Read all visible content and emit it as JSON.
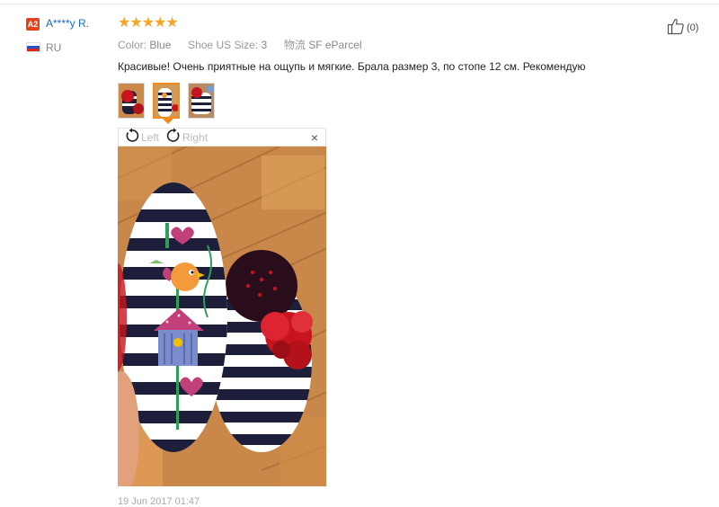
{
  "reviewer": {
    "badge": "A2",
    "name": "A****y R.",
    "country": "RU"
  },
  "review": {
    "rating": "★★★★★",
    "attributes": [
      {
        "label": "Color:",
        "value": "Blue"
      },
      {
        "label": "Shoe US Size:",
        "value": "3"
      },
      {
        "label": "物流",
        "value": "SF eParcel"
      }
    ],
    "helpful_count": "(0)",
    "text": "Красивые! Очень приятные на ощупь и мягкие. Брала размер 3, по стопе 12 см. Рекомендую",
    "date": "19 Jun 2017 01:47"
  },
  "viewer": {
    "rotate_left_label": "Left",
    "rotate_right_label": "Right",
    "close_label": "×"
  },
  "colors": {
    "accent": "#f08c1e",
    "star": "#f5a623",
    "link": "#1e69b8",
    "badge": "#e5411d"
  }
}
